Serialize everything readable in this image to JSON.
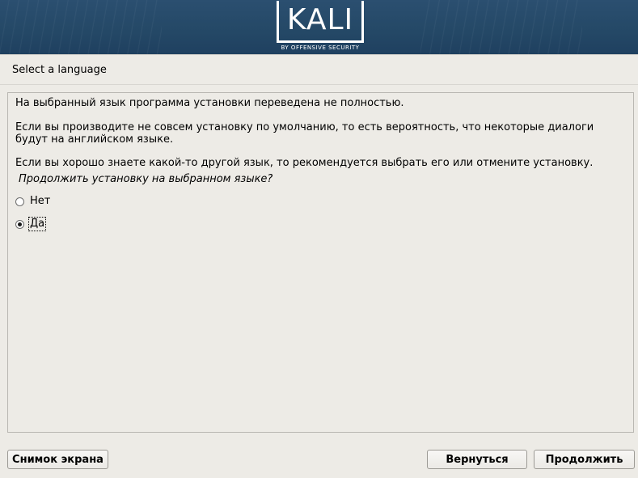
{
  "banner": {
    "logo_text": "KALI",
    "logo_subtitle": "BY OFFENSIVE SECURITY"
  },
  "page": {
    "title": "Select a language"
  },
  "content": {
    "paragraph1": "На выбранный язык программа установки переведена не полностью.",
    "paragraph2": "Если вы производите не совсем установку по умолчанию, то есть вероятность, что некоторые диалоги будут на английском языке.",
    "paragraph3": "Если вы хорошо знаете какой-то другой язык, то рекомендуется выбрать его или отмените установку.",
    "question": "Продолжить установку на выбранном языке?",
    "options": [
      {
        "label": "Нет",
        "selected": false
      },
      {
        "label": "Да",
        "selected": true
      }
    ]
  },
  "buttons": {
    "screenshot": "Снимок экрана",
    "back": "Вернуться",
    "continue": "Продолжить"
  }
}
